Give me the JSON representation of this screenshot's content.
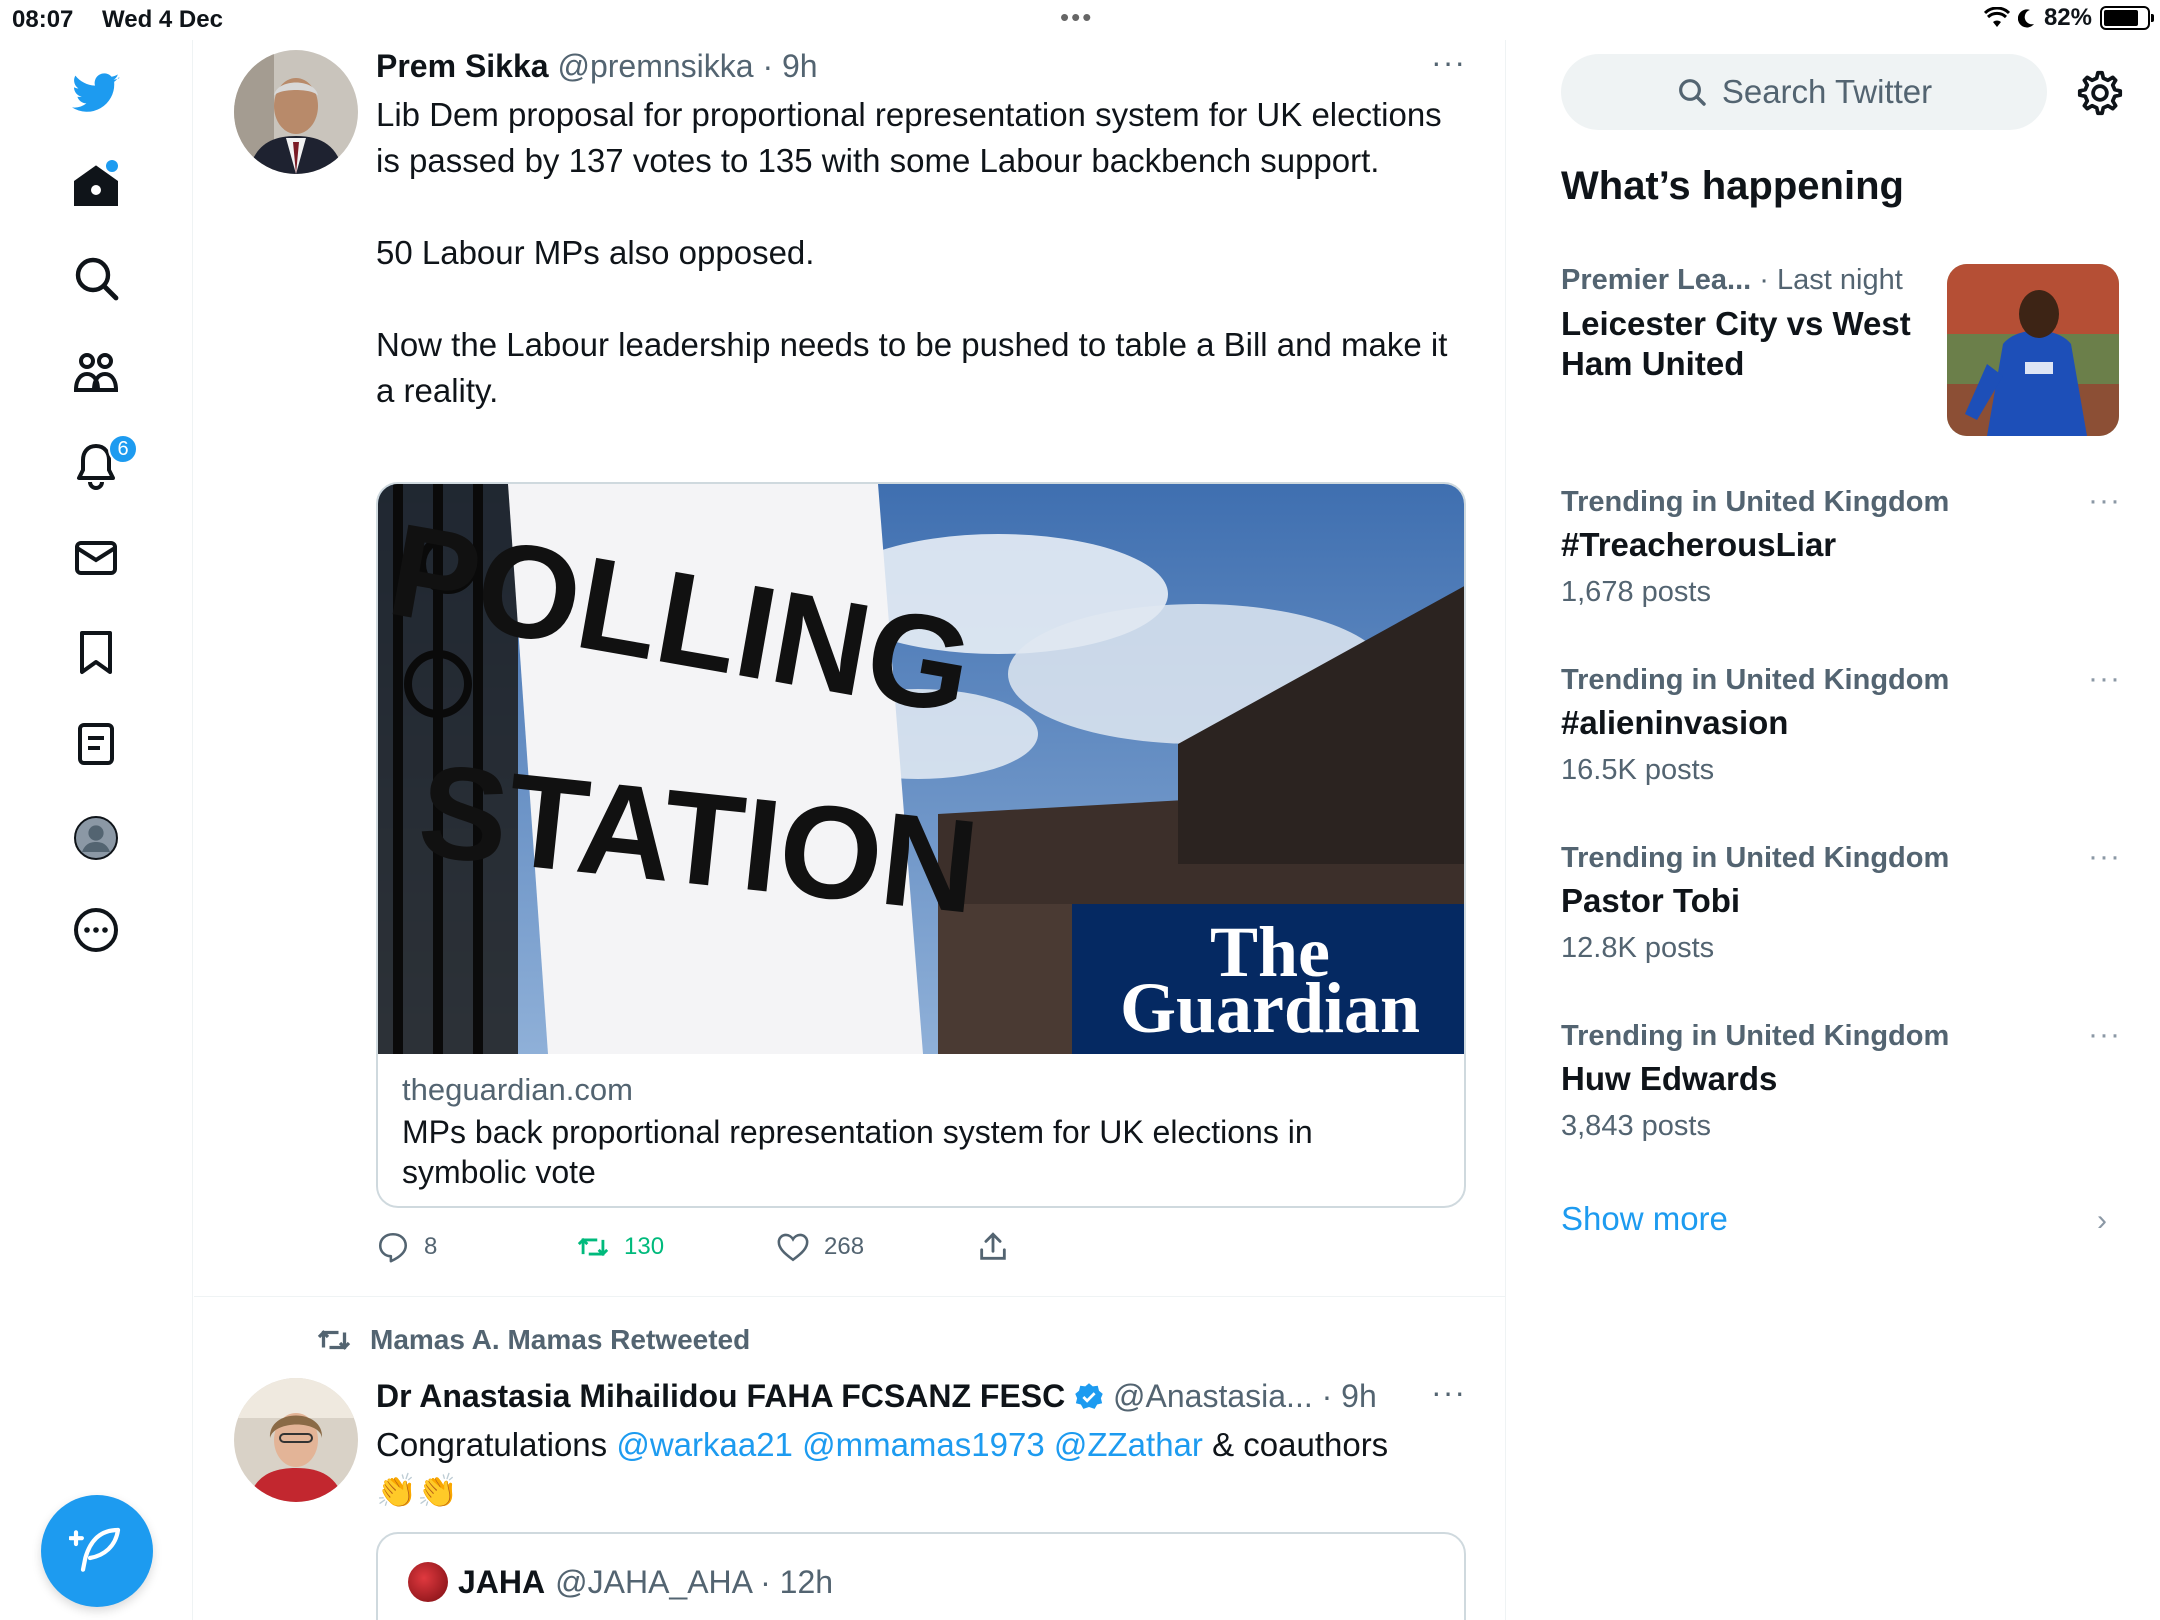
{
  "status_bar": {
    "time": "08:07",
    "date": "Wed 4 Dec",
    "battery": "82%",
    "battery_level": 0.82
  },
  "nav": {
    "notifications_badge": "6",
    "accent": "#1d9bf0"
  },
  "tweet1": {
    "name": "Prem Sikka",
    "handle": "@premnsikka",
    "time": "9h",
    "more": "···",
    "paragraphs": [
      "Lib Dem proposal for proportional representation system for UK elections is passed by 137 votes to 135 with some Labour backbench support.",
      "50 Labour MPs also opposed.",
      "Now the Labour leadership needs to be pushed to table a Bill and make it a reality."
    ],
    "card": {
      "sign_line1": "POLLING",
      "sign_line2": "STATION",
      "brand_line1": "The",
      "brand_line2": "Guardian",
      "domain": "theguardian.com",
      "title": "MPs back proportional representation system for UK elections in symbolic vote"
    },
    "replies": "8",
    "retweets": "130",
    "likes": "268"
  },
  "tweet2": {
    "retweeted_by": "Mamas A. Mamas Retweeted",
    "name": "Dr Anastasia Mihailidou FAHA FCSANZ FESC",
    "handle": "@Anastasia...",
    "time": "9h",
    "more": "···",
    "text_start": "Congratulations ",
    "mention1": "@warkaa21",
    "mention2": "@mmamas1973",
    "mention3": "@ZZathar",
    "text_end": " & coauthors",
    "emoji": "👏👏",
    "quote": {
      "name": "JAHA",
      "handle": "@JAHA_AHA",
      "time": "12h"
    }
  },
  "right": {
    "search_placeholder": "Search Twitter",
    "whats_happening": "What’s happening",
    "featured": {
      "category": "Premier Lea...",
      "time": "· Last night",
      "title": "Leicester City vs West Ham United"
    },
    "trends": [
      {
        "category": "Trending in United Kingdom",
        "name": "#TreacherousLiar",
        "count": "1,678 posts"
      },
      {
        "category": "Trending in United Kingdom",
        "name": "#alieninvasion",
        "count": "16.5K posts"
      },
      {
        "category": "Trending in United Kingdom",
        "name": "Pastor Tobi",
        "count": "12.8K posts"
      },
      {
        "category": "Trending in United Kingdom",
        "name": "Huw Edwards",
        "count": "3,843 posts"
      }
    ],
    "show_more": "Show more",
    "trend_more": "···",
    "chevron": "›"
  }
}
